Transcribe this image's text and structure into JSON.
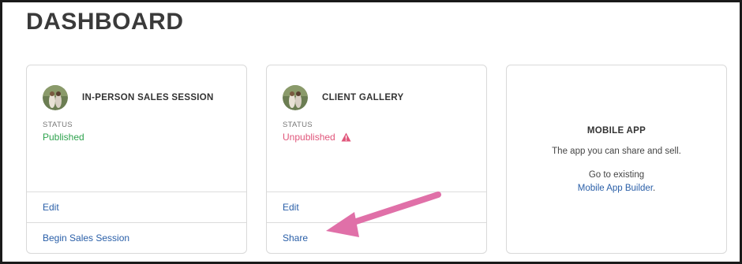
{
  "header": {
    "title": "DASHBOARD"
  },
  "cards": [
    {
      "title": "IN-PERSON SALES SESSION",
      "status_label": "STATUS",
      "status_value": "Published",
      "actions": [
        "Edit",
        "Begin Sales Session"
      ]
    },
    {
      "title": "CLIENT GALLERY",
      "status_label": "STATUS",
      "status_value": "Unpublished",
      "status_icon": "warning-icon",
      "actions": [
        "Edit",
        "Share"
      ]
    }
  ],
  "mobile_app": {
    "title": "MOBILE APP",
    "description": "The app you can share and sell.",
    "goto_text": "Go to existing",
    "link_label": "Mobile App Builder",
    "link_suffix": "."
  },
  "colors": {
    "published": "#2fa34e",
    "unpublished": "#e0557a",
    "link": "#2a5fa8",
    "annotation_arrow": "#e070a8"
  }
}
